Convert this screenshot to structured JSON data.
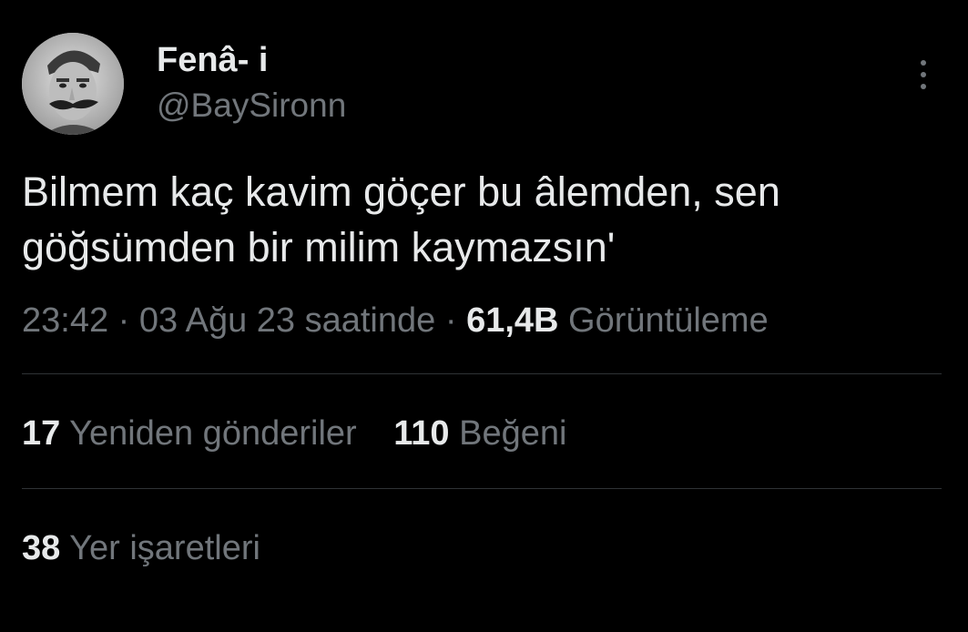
{
  "user": {
    "display_name": "Fenâ- i",
    "handle": "@BaySironn",
    "avatar_icon": "profile-photo"
  },
  "tweet": {
    "text_lines": [
      "Bilmem kaç kavim göçer bu âlemden, sen",
      "göğsümden bir milim kaymazsın'"
    ],
    "time": "23:42",
    "separator": "·",
    "date": "03 Ağu 23 saatinde",
    "views_count": "61,4B",
    "views_label": "Görüntüleme"
  },
  "stats": {
    "retweets": {
      "count": "17",
      "label": "Yeniden gönderiler"
    },
    "likes": {
      "count": "110",
      "label": "Beğeni"
    },
    "bookmarks": {
      "count": "38",
      "label": "Yer işaretleri"
    }
  },
  "colors": {
    "background": "#000000",
    "primary_text": "#e7e9ea",
    "secondary_text": "#71767b",
    "divider": "#2f3336"
  },
  "icons": {
    "more": "more-vertical-icon"
  }
}
